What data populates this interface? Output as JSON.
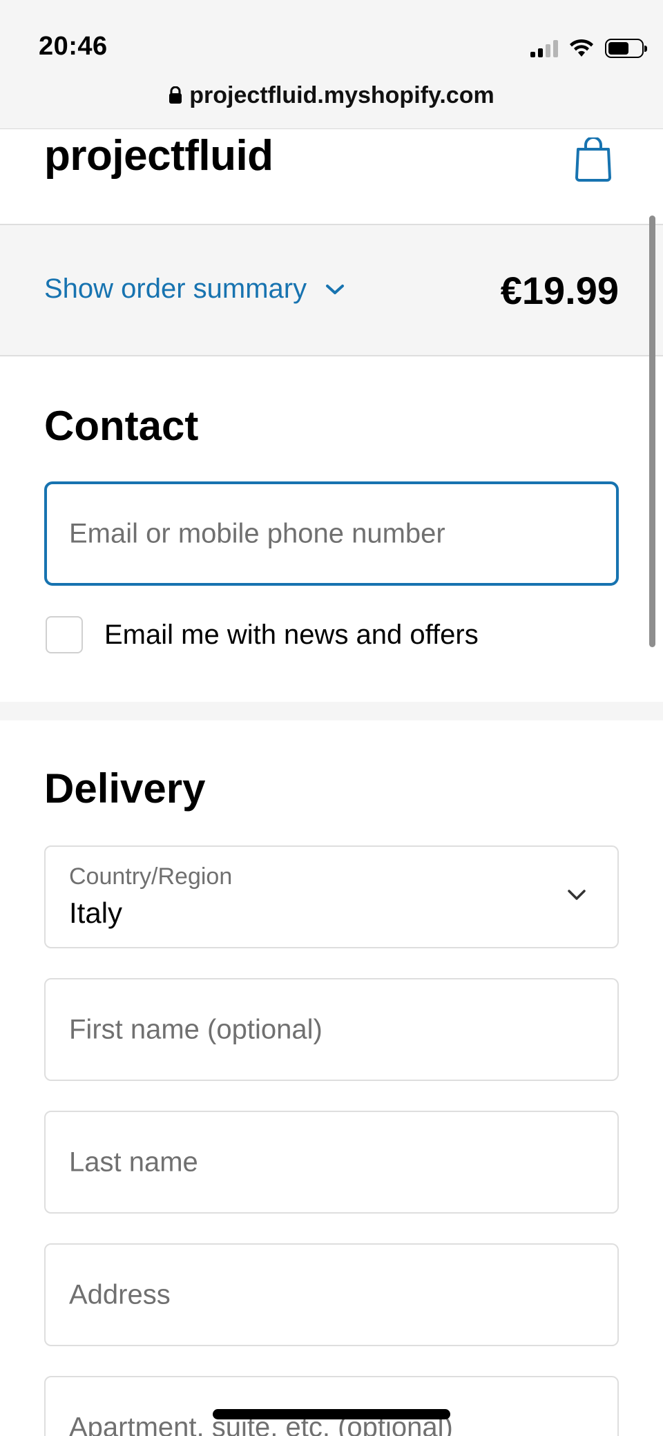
{
  "status_bar": {
    "time": "20:46",
    "icons": [
      "cellular-signal-icon",
      "wifi-icon",
      "battery-icon"
    ],
    "battery_level": 0.62
  },
  "url_bar": {
    "lock_icon": "lock-icon",
    "url": "projectfluid.myshopify.com"
  },
  "header": {
    "store_name": "projectfluid",
    "cart_icon": "shopping-bag-icon"
  },
  "order_summary": {
    "toggle_label": "Show order summary",
    "chevron_icon": "chevron-down-icon",
    "total": "€19.99"
  },
  "contact": {
    "title": "Contact",
    "email_placeholder": "Email or mobile phone number",
    "newsletter_label": "Email me with news and offers",
    "newsletter_checked": false
  },
  "delivery": {
    "title": "Delivery",
    "country_label": "Country/Region",
    "country_value": "Italy",
    "first_name_placeholder": "First name (optional)",
    "last_name_placeholder": "Last name",
    "address_placeholder": "Address",
    "apartment_placeholder": "Apartment, suite, etc. (optional)"
  },
  "colors": {
    "accent": "#1773b0",
    "band_background": "#f5f5f5",
    "border": "#dedede",
    "placeholder": "#707070"
  }
}
